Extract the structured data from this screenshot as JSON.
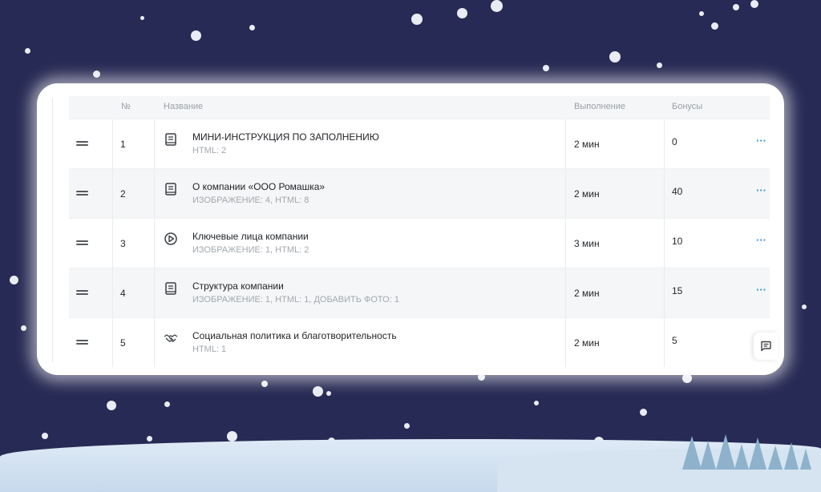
{
  "table": {
    "headers": {
      "number": "№",
      "name": "Название",
      "duration": "Выполнение",
      "bonuses": "Бонусы"
    },
    "rows": [
      {
        "number": "1",
        "icon": "book-icon",
        "title": "МИНИ-ИНСТРУКЦИЯ ПО ЗАПОЛНЕНИЮ",
        "subtitle": "HTML: 2",
        "duration": "2 мин",
        "bonuses": "0",
        "more": "···"
      },
      {
        "number": "2",
        "icon": "book-icon",
        "title": "О компании «ООО Ромашка»",
        "subtitle": "ИЗОБРАЖЕНИЕ: 4, HTML: 8",
        "duration": "2 мин",
        "bonuses": "40",
        "more": "···"
      },
      {
        "number": "3",
        "icon": "play-circle-icon",
        "title": "Ключевые лица компании",
        "subtitle": "ИЗОБРАЖЕНИЕ: 1, HTML: 2",
        "duration": "3 мин",
        "bonuses": "10",
        "more": "···"
      },
      {
        "number": "4",
        "icon": "book-icon",
        "title": "Структура компании",
        "subtitle": "ИЗОБРАЖЕНИЕ: 1, HTML: 1, ДОБАВИТЬ ФОТО: 1",
        "duration": "2 мин",
        "bonuses": "15",
        "more": "···"
      },
      {
        "number": "5",
        "icon": "handshake-icon",
        "title": "Социальная политика и благотворительность",
        "subtitle": "HTML: 1",
        "duration": "2 мин",
        "bonuses": "5",
        "more": ""
      }
    ]
  },
  "colors": {
    "background": "#272a54",
    "accent": "#2d93d6",
    "row_alt": "#f5f6f7"
  },
  "widgets": {
    "chat": "chat-icon"
  }
}
